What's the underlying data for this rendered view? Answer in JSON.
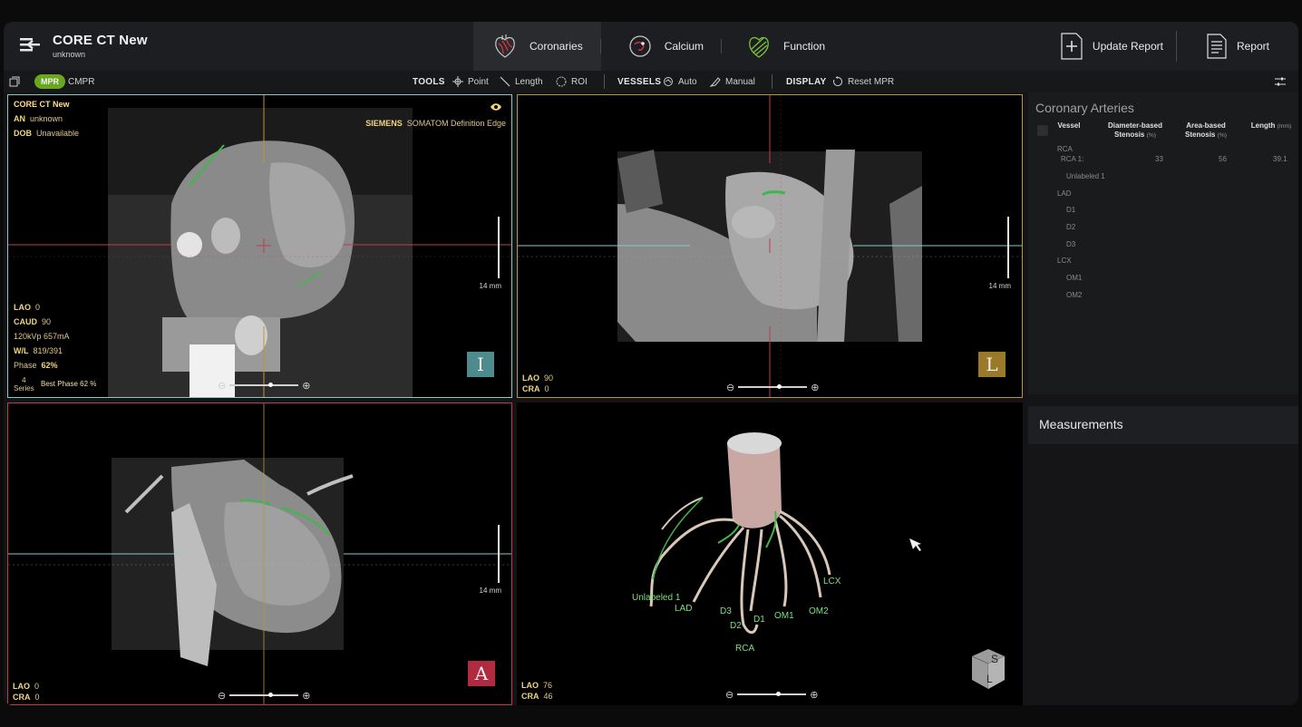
{
  "app": {
    "title": "CORE CT New",
    "subtitle": "unknown"
  },
  "tabs": [
    {
      "label": "Coronaries",
      "icon": "heart-vessels-icon",
      "active": true
    },
    {
      "label": "Calcium",
      "icon": "calcium-icon",
      "active": false
    },
    {
      "label": "Function",
      "icon": "function-icon",
      "active": false
    }
  ],
  "header_actions": {
    "update_report": "Update Report",
    "report": "Report"
  },
  "toolbar": {
    "mpr": "MPR",
    "cmpr": "CMPR",
    "tools_label": "TOOLS",
    "point": "Point",
    "length": "Length",
    "roi": "ROI",
    "vessels_label": "VESSELS",
    "auto": "Auto",
    "manual": "Manual",
    "display_label": "DISPLAY",
    "reset_mpr": "Reset MPR"
  },
  "viewport_tl": {
    "patient": "CORE CT New",
    "an_label": "AN",
    "an_value": "unknown",
    "dob_label": "DOB",
    "dob_value": "Unavailable",
    "vendor": "SIEMENS",
    "scanner": "SOMATOM Definition Edge",
    "lao_label": "LAO",
    "lao_value": "0",
    "caud_label": "CAUD",
    "caud_value": "90",
    "kvp": "120kVp 657mA",
    "wl_label": "W/L",
    "wl_value": "819/391",
    "phase_label": "Phase",
    "phase_value": "62%",
    "series_count": "4",
    "series_label": "Series",
    "best_phase": "Best Phase 62 %",
    "scale": "14 mm",
    "orientation": "I"
  },
  "viewport_tr": {
    "lao_label": "LAO",
    "lao_value": "90",
    "cra_label": "CRA",
    "cra_value": "0",
    "scale": "14 mm",
    "orientation": "L"
  },
  "viewport_bl": {
    "lao_label": "LAO",
    "lao_value": "0",
    "cra_label": "CRA",
    "cra_value": "0",
    "scale": "14 mm",
    "orientation": "A"
  },
  "viewport_br": {
    "lao_label": "LAO",
    "lao_value": "76",
    "cra_label": "CRA",
    "cra_value": "46",
    "vessel_labels": [
      "Unlabeled 1",
      "LAD",
      "D3",
      "D2",
      "D1",
      "OM1",
      "OM2",
      "LCX",
      "RCA"
    ],
    "cube_top": "S",
    "cube_side": "L"
  },
  "coronary_arteries": {
    "title": "Coronary Arteries",
    "col_vessel": "Vessel",
    "col_diam": "Diameter-based",
    "col_diam2": "Stenosis",
    "col_area": "Area-based",
    "col_area2": "Stenosis",
    "col_len": "Length",
    "unit_pct": "(%)",
    "unit_mm": "(mm)",
    "rows": [
      {
        "name": "RCA",
        "indent": 0
      },
      {
        "name": "RCA 1:",
        "indent": 1,
        "diam": "33",
        "area": "56",
        "length": "39.1"
      },
      {
        "name": "Unlabeled 1",
        "indent": 2
      },
      {
        "name": "LAD",
        "indent": 0
      },
      {
        "name": "D1",
        "indent": 2
      },
      {
        "name": "D2",
        "indent": 2
      },
      {
        "name": "D3",
        "indent": 2
      },
      {
        "name": "LCX",
        "indent": 0
      },
      {
        "name": "OM1",
        "indent": 2
      },
      {
        "name": "OM2",
        "indent": 2
      }
    ]
  },
  "measurements": {
    "title": "Measurements"
  }
}
